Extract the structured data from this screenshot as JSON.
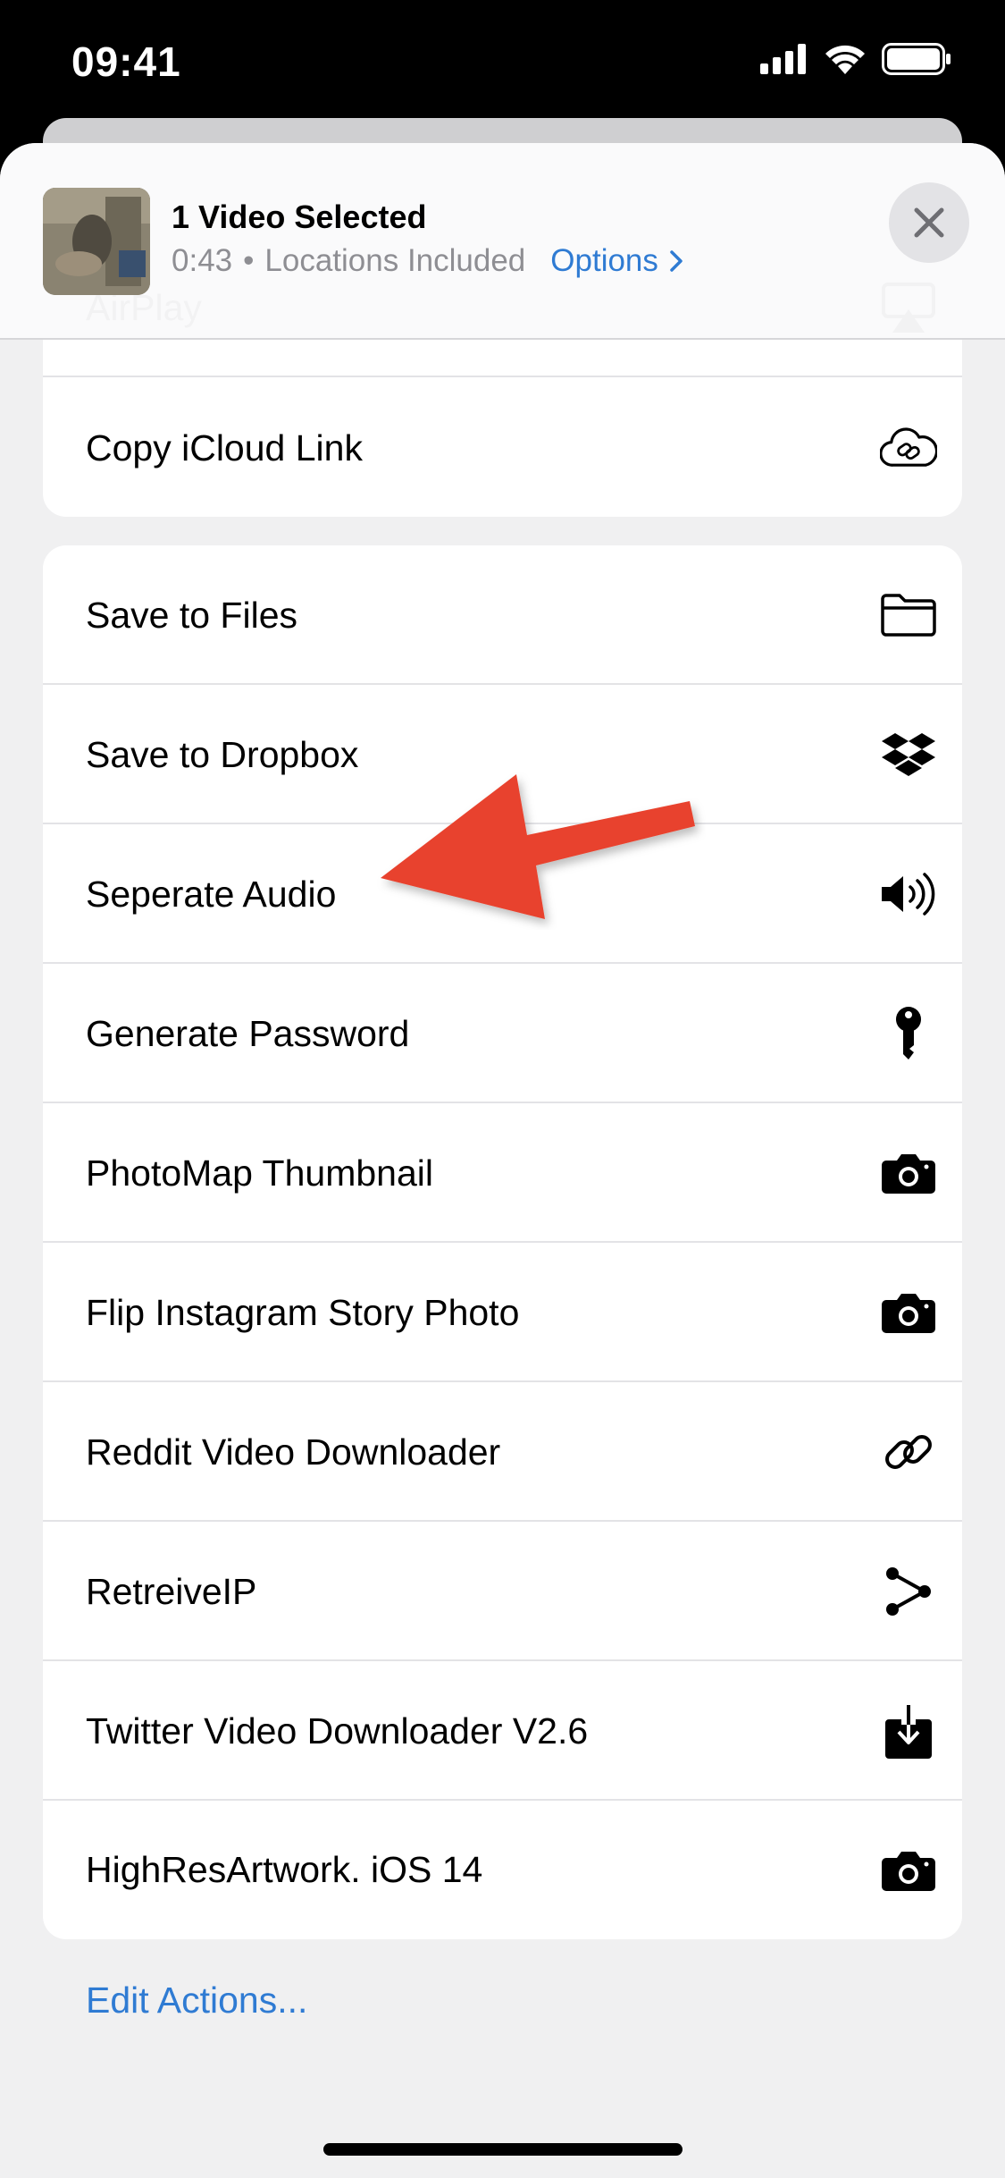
{
  "status_bar": {
    "time": "09:41"
  },
  "share_header": {
    "title": "1 Video Selected",
    "duration": "0:43",
    "separator": "•",
    "location_text": "Locations Included",
    "options_label": "Options"
  },
  "card1": {
    "items": [
      {
        "label": "AirPlay",
        "icon": "airplay-icon"
      },
      {
        "label": "Copy iCloud Link",
        "icon": "cloud-link-icon"
      }
    ]
  },
  "actions": [
    {
      "label": "Save to Files",
      "icon": "folder-icon"
    },
    {
      "label": "Save to Dropbox",
      "icon": "dropbox-icon"
    },
    {
      "label": "Seperate Audio",
      "icon": "speaker-icon"
    },
    {
      "label": "Generate Password",
      "icon": "key-icon"
    },
    {
      "label": "PhotoMap Thumbnail",
      "icon": "camera-icon"
    },
    {
      "label": "Flip Instagram Story Photo",
      "icon": "camera-icon"
    },
    {
      "label": "Reddit Video Downloader",
      "icon": "link-icon"
    },
    {
      "label": "RetreiveIP",
      "icon": "share-nodes-icon"
    },
    {
      "label": "Twitter Video Downloader V2.6",
      "icon": "download-tray-icon"
    },
    {
      "label": "HighResArtwork. iOS 14",
      "icon": "camera-icon"
    }
  ],
  "edit_actions_label": "Edit Actions...",
  "colors": {
    "accent": "#2f7bd3",
    "annotation_arrow": "#e8432d",
    "sheet_background": "#f0f0f1"
  }
}
